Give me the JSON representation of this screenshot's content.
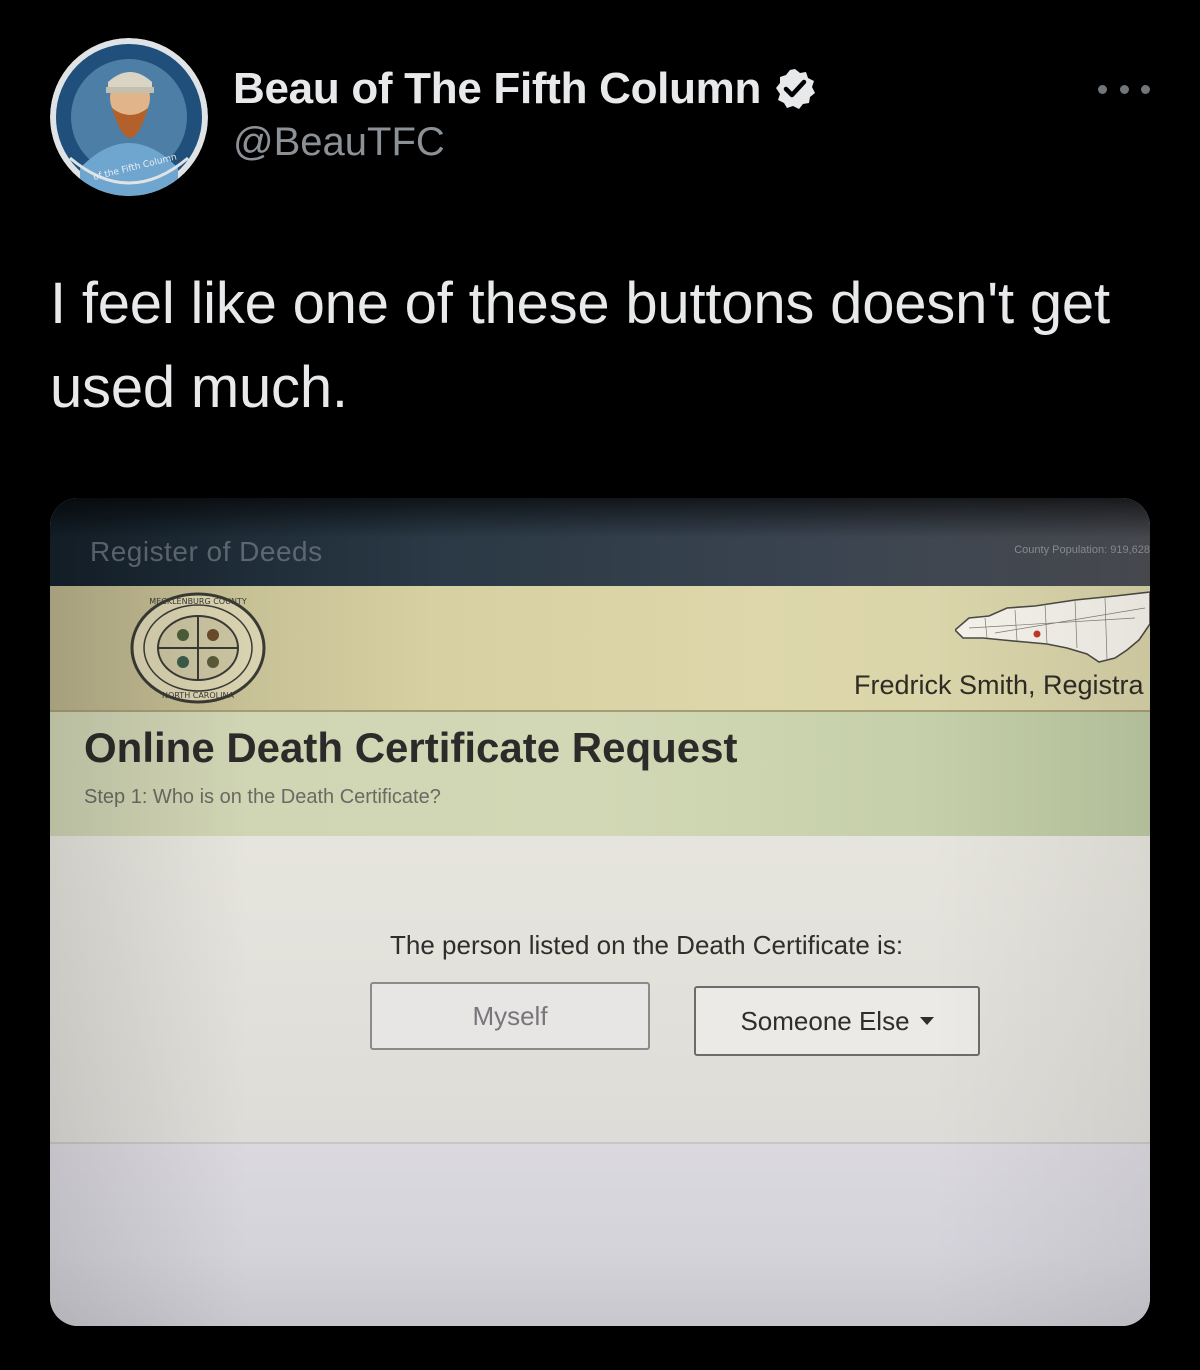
{
  "tweet": {
    "author_name": "Beau of The Fifth Column",
    "author_handle": "@BeauTFC",
    "verified": true,
    "text": "I feel like one of these buttons doesn't get used much."
  },
  "photo": {
    "site_title": "Register of Deeds",
    "county_population": "County Population: 919,628",
    "registrar": "Fredrick Smith, Registra",
    "form_title": "Online Death Certificate Request",
    "step_label": "Step 1: Who is on the Death Certificate?",
    "question": "The person listed on the Death Certificate is:",
    "buttons": [
      {
        "label": "Myself"
      },
      {
        "label": "Someone Else",
        "icon": "caret-down-icon"
      }
    ]
  },
  "colors": {
    "background": "#000000",
    "primary_text": "#e7e9ea",
    "secondary_text": "#8b9196",
    "verified_badge": "#e7e9ea"
  },
  "icons": {
    "verified": "verified-badge-icon",
    "more": "more-options-icon",
    "seal": "county-seal-icon",
    "map": "nc-map-icon"
  }
}
